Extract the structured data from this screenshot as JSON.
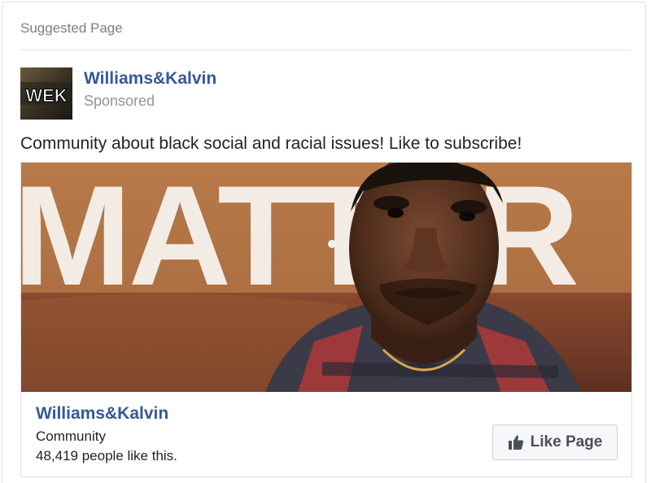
{
  "header": {
    "title": "Suggested Page"
  },
  "post": {
    "page_name": "Williams&Kalvin",
    "sponsored_label": "Sponsored",
    "avatar_text": "WEK",
    "text": "Community about black social and racial issues! Like to subscribe!"
  },
  "media": {
    "banner_text": "MATTER"
  },
  "attachment": {
    "title": "Williams&Kalvin",
    "category": "Community",
    "likes": "48,419 people like this.",
    "like_button_label": "Like Page"
  },
  "colors": {
    "link_blue": "#365899",
    "secondary_text": "#90949c",
    "button_bg": "#f6f7f9"
  },
  "icons": {
    "like": "thumbs-up-icon"
  }
}
